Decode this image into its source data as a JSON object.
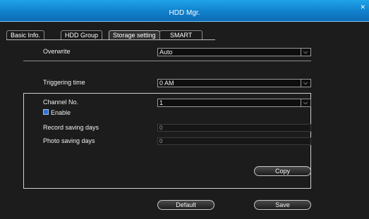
{
  "window": {
    "title": "HDD Mgr."
  },
  "icons": {
    "close": "close-icon",
    "dropdown": "chevron-down-icon"
  },
  "tabs": [
    {
      "label": "Basic Info."
    },
    {
      "label": "HDD Group"
    },
    {
      "label": "Storage setting",
      "active": true
    },
    {
      "label": "SMART"
    }
  ],
  "overwrite": {
    "label": "Overwrite",
    "value": "Auto"
  },
  "triggering": {
    "label": "Triggering time",
    "value": "0 AM"
  },
  "channel": {
    "label": "Channel No.",
    "value": "1"
  },
  "enable": {
    "label": "Enable",
    "checked": true
  },
  "record_days": {
    "label": "Record saving days",
    "value": "0"
  },
  "photo_days": {
    "label": "Photo saving days",
    "value": "0"
  },
  "buttons": {
    "copy": "Copy",
    "default": "Default",
    "save": "Save"
  },
  "colors": {
    "titlebar": "#1180cc",
    "checkbox": "#2f6fd6",
    "background": "#1c1c1c"
  }
}
